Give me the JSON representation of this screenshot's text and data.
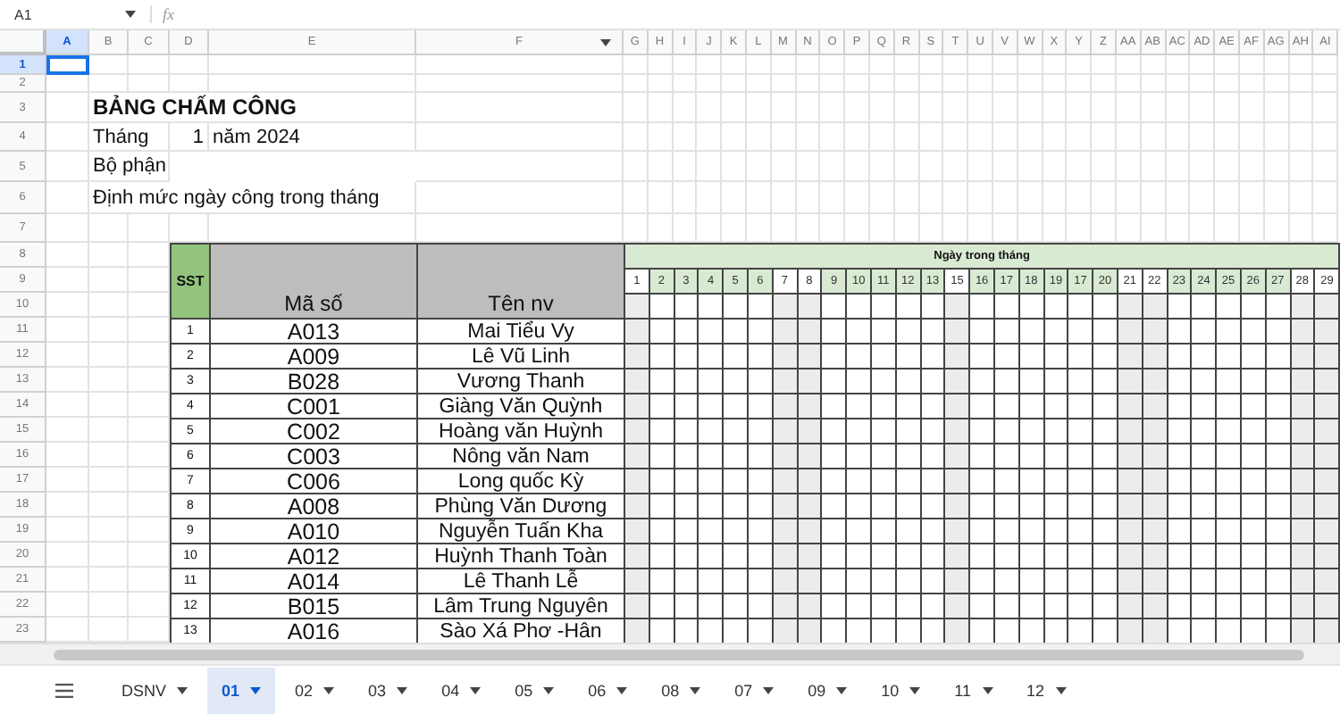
{
  "formula_bar": {
    "name_box": "A1",
    "fx": "fx"
  },
  "column_headers": [
    {
      "label": "A",
      "selected": true
    },
    {
      "label": "B",
      "selected": false
    },
    {
      "label": "C",
      "selected": false
    },
    {
      "label": "D",
      "selected": false
    },
    {
      "label": "E",
      "selected": false
    },
    {
      "label": "F",
      "selected": false
    },
    {
      "label": "G",
      "selected": false
    },
    {
      "label": "H",
      "selected": false
    },
    {
      "label": "I",
      "selected": false
    },
    {
      "label": "J",
      "selected": false
    },
    {
      "label": "K",
      "selected": false
    },
    {
      "label": "L",
      "selected": false
    },
    {
      "label": "M",
      "selected": false
    },
    {
      "label": "N",
      "selected": false
    },
    {
      "label": "O",
      "selected": false
    },
    {
      "label": "P",
      "selected": false
    },
    {
      "label": "Q",
      "selected": false
    },
    {
      "label": "R",
      "selected": false
    },
    {
      "label": "S",
      "selected": false
    },
    {
      "label": "T",
      "selected": false
    },
    {
      "label": "U",
      "selected": false
    },
    {
      "label": "V",
      "selected": false
    },
    {
      "label": "W",
      "selected": false
    },
    {
      "label": "X",
      "selected": false
    },
    {
      "label": "Y",
      "selected": false
    },
    {
      "label": "Z",
      "selected": false
    },
    {
      "label": "AA",
      "selected": false
    },
    {
      "label": "AB",
      "selected": false
    },
    {
      "label": "AC",
      "selected": false
    },
    {
      "label": "AD",
      "selected": false
    },
    {
      "label": "AE",
      "selected": false
    },
    {
      "label": "AF",
      "selected": false
    },
    {
      "label": "AG",
      "selected": false
    },
    {
      "label": "AH",
      "selected": false
    },
    {
      "label": "AI",
      "selected": false
    }
  ],
  "row_headers": [
    {
      "label": "1",
      "selected": true
    },
    {
      "label": "2",
      "selected": false
    },
    {
      "label": "3",
      "selected": false
    },
    {
      "label": "4",
      "selected": false
    },
    {
      "label": "5",
      "selected": false
    },
    {
      "label": "6",
      "selected": false
    },
    {
      "label": "7",
      "selected": false
    },
    {
      "label": "8",
      "selected": false
    },
    {
      "label": "9",
      "selected": false
    },
    {
      "label": "10",
      "selected": false
    },
    {
      "label": "11",
      "selected": false
    },
    {
      "label": "12",
      "selected": false
    },
    {
      "label": "13",
      "selected": false
    },
    {
      "label": "14",
      "selected": false
    },
    {
      "label": "15",
      "selected": false
    },
    {
      "label": "16",
      "selected": false
    },
    {
      "label": "17",
      "selected": false
    },
    {
      "label": "18",
      "selected": false
    },
    {
      "label": "19",
      "selected": false
    },
    {
      "label": "20",
      "selected": false
    },
    {
      "label": "21",
      "selected": false
    },
    {
      "label": "22",
      "selected": false
    },
    {
      "label": "23",
      "selected": false
    }
  ],
  "sheet": {
    "title": "BẢNG CHẤM CÔNG",
    "month_label": "Tháng",
    "month_value": "1",
    "year_label": "năm 2024",
    "department_label": "Bộ phận",
    "quota_label": "Định mức ngày công trong tháng"
  },
  "table": {
    "columns": [
      "SST",
      "Mã số",
      "Tên nv"
    ],
    "days_heading": "Ngày trong tháng",
    "days": [
      {
        "label": "1",
        "weekend": true
      },
      {
        "label": "2",
        "weekend": false
      },
      {
        "label": "3",
        "weekend": false
      },
      {
        "label": "4",
        "weekend": false
      },
      {
        "label": "5",
        "weekend": false
      },
      {
        "label": "6",
        "weekend": false
      },
      {
        "label": "7",
        "weekend": true
      },
      {
        "label": "8",
        "weekend": true
      },
      {
        "label": "9",
        "weekend": false
      },
      {
        "label": "10",
        "weekend": false
      },
      {
        "label": "11",
        "weekend": false
      },
      {
        "label": "12",
        "weekend": false
      },
      {
        "label": "13",
        "weekend": false
      },
      {
        "label": "15",
        "weekend": true
      },
      {
        "label": "16",
        "weekend": false
      },
      {
        "label": "17",
        "weekend": false
      },
      {
        "label": "18",
        "weekend": false
      },
      {
        "label": "19",
        "weekend": false
      },
      {
        "label": "17",
        "weekend": false
      },
      {
        "label": "20",
        "weekend": false
      },
      {
        "label": "21",
        "weekend": true
      },
      {
        "label": "22",
        "weekend": true
      },
      {
        "label": "23",
        "weekend": false
      },
      {
        "label": "24",
        "weekend": false
      },
      {
        "label": "25",
        "weekend": false
      },
      {
        "label": "26",
        "weekend": false
      },
      {
        "label": "27",
        "weekend": false
      },
      {
        "label": "28",
        "weekend": true
      },
      {
        "label": "29",
        "weekend": true
      }
    ],
    "rows": [
      {
        "sst": "1",
        "code": "A013",
        "name": "Mai Tiểu Vy"
      },
      {
        "sst": "2",
        "code": "A009",
        "name": "Lê Vũ Linh"
      },
      {
        "sst": "3",
        "code": "B028",
        "name": "Vương Thanh"
      },
      {
        "sst": "4",
        "code": "C001",
        "name": "Giàng Văn Quỳnh"
      },
      {
        "sst": "5",
        "code": "C002",
        "name": "Hoàng văn Huỳnh"
      },
      {
        "sst": "6",
        "code": "C003",
        "name": "Nông văn Nam"
      },
      {
        "sst": "7",
        "code": "C006",
        "name": "Long quốc Kỳ"
      },
      {
        "sst": "8",
        "code": "A008",
        "name": "Phùng Văn Dương"
      },
      {
        "sst": "9",
        "code": "A010",
        "name": "Nguyễn Tuấn Kha"
      },
      {
        "sst": "10",
        "code": "A012",
        "name": "Huỳnh Thanh Toàn"
      },
      {
        "sst": "11",
        "code": "A014",
        "name": "Lê Thanh Lễ"
      },
      {
        "sst": "12",
        "code": "B015",
        "name": "Lâm Trung Nguyên"
      },
      {
        "sst": "13",
        "code": "A016",
        "name": "Sào Xá Phơ -Hân"
      }
    ]
  },
  "sheet_tabs": [
    {
      "label": "DSNV",
      "selected": false
    },
    {
      "label": "01",
      "selected": true
    },
    {
      "label": "02",
      "selected": false
    },
    {
      "label": "03",
      "selected": false
    },
    {
      "label": "04",
      "selected": false
    },
    {
      "label": "05",
      "selected": false
    },
    {
      "label": "06",
      "selected": false
    },
    {
      "label": "08",
      "selected": false
    },
    {
      "label": "07",
      "selected": false
    },
    {
      "label": "09",
      "selected": false
    },
    {
      "label": "10",
      "selected": false
    },
    {
      "label": "11",
      "selected": false
    },
    {
      "label": "12",
      "selected": false
    }
  ]
}
